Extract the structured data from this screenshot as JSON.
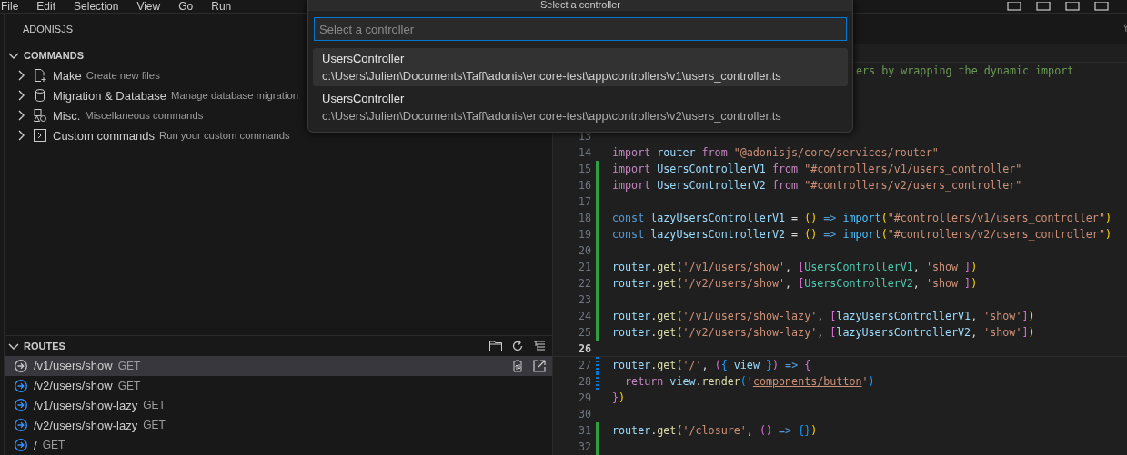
{
  "menu_bar": [
    "File",
    "Edit",
    "Selection",
    "View",
    "Go",
    "Run"
  ],
  "sidebar": {
    "title": "ADONISJS",
    "commands": {
      "label": "COMMANDS",
      "expanded": true,
      "items": [
        {
          "label": "Make",
          "description": "Create new files",
          "kind": "file",
          "expanded": false
        },
        {
          "label": "Migration & Database",
          "description": "Manage database migration",
          "kind": "database",
          "expanded": false
        },
        {
          "label": "Misc.",
          "description": "Miscellaneous commands",
          "kind": "shapes",
          "expanded": false
        },
        {
          "label": "Custom commands",
          "description": "Run your custom commands",
          "kind": "terminal",
          "expanded": false
        }
      ]
    },
    "routes": {
      "label": "ROUTES",
      "expanded": true,
      "items": [
        {
          "path": "/v1/users/show",
          "method": "GET",
          "selected": true
        },
        {
          "path": "/v2/users/show",
          "method": "GET",
          "selected": false
        },
        {
          "path": "/v1/users/show-lazy",
          "method": "GET",
          "selected": false
        },
        {
          "path": "/v2/users/show-lazy",
          "method": "GET",
          "selected": false
        },
        {
          "path": "/",
          "method": "GET",
          "selected": false
        }
      ]
    }
  },
  "quick_pick": {
    "title": "Select a controller",
    "placeholder": "Select a controller",
    "items": [
      {
        "label": "UsersController",
        "detail": "c:\\Users\\Julien\\Documents\\Taff\\adonis\\encore-test\\app\\controllers\\v1\\users_controller.ts",
        "selected": true
      },
      {
        "label": "UsersController",
        "detail": "c:\\Users\\Julien\\Documents\\Taff\\adonis\\encore-test\\app\\controllers\\v2\\users_controller.ts",
        "selected": false
      }
    ]
  },
  "editor": {
    "lines": [
      {
        "clipped": true,
        "tokens": [
          {
            "text": "ers by wrapping the dynamic import",
            "kind": "comment"
          }
        ]
      },
      {
        "number": "13",
        "added": false,
        "modified": false
      },
      {
        "number": "14",
        "added": false,
        "modified": false,
        "tokens": [
          {
            "text": "import ",
            "kind": "keyword"
          },
          {
            "text": "router ",
            "kind": "variable"
          },
          {
            "text": "from ",
            "kind": "keyword"
          },
          {
            "text": "\"@adonisjs/core/services/router\"",
            "kind": "string"
          }
        ]
      },
      {
        "number": "15",
        "added": true,
        "modified": false,
        "tokens": [
          {
            "text": "import ",
            "kind": "keyword"
          },
          {
            "text": "UsersControllerV1 ",
            "kind": "variable"
          },
          {
            "text": "from ",
            "kind": "keyword"
          },
          {
            "text": "\"#controllers/v1/users_controller\"",
            "kind": "string"
          }
        ]
      },
      {
        "number": "16",
        "added": true,
        "modified": false,
        "tokens": [
          {
            "text": "import ",
            "kind": "keyword"
          },
          {
            "text": "UsersControllerV2 ",
            "kind": "variable"
          },
          {
            "text": "from ",
            "kind": "keyword"
          },
          {
            "text": "\"#controllers/v2/users_controller\"",
            "kind": "string"
          }
        ]
      },
      {
        "number": "17",
        "added": true,
        "modified": false
      },
      {
        "number": "18",
        "added": true,
        "modified": false,
        "tokens": [
          {
            "text": "const ",
            "kind": "storage"
          },
          {
            "text": "lazyUsersControllerV1",
            "kind": "variable"
          },
          {
            "text": " = ",
            "kind": "plain"
          },
          {
            "text": "() ",
            "kind": "bracket1"
          },
          {
            "text": "=> ",
            "kind": "storage"
          },
          {
            "text": "import",
            "kind": "call"
          },
          {
            "text": "(",
            "kind": "bracket1"
          },
          {
            "text": "\"#controllers/v1/users_controller\"",
            "kind": "string"
          },
          {
            "text": ")",
            "kind": "bracket1"
          }
        ]
      },
      {
        "number": "19",
        "added": true,
        "modified": false,
        "tokens": [
          {
            "text": "const ",
            "kind": "storage"
          },
          {
            "text": "lazyUsersControllerV2",
            "kind": "variable"
          },
          {
            "text": " = ",
            "kind": "plain"
          },
          {
            "text": "() ",
            "kind": "bracket1"
          },
          {
            "text": "=> ",
            "kind": "storage"
          },
          {
            "text": "import",
            "kind": "call"
          },
          {
            "text": "(",
            "kind": "bracket1"
          },
          {
            "text": "\"#controllers/v2/users_controller\"",
            "kind": "string"
          },
          {
            "text": ")",
            "kind": "bracket1"
          }
        ]
      },
      {
        "number": "20",
        "added": true,
        "modified": false
      },
      {
        "number": "21",
        "added": true,
        "modified": false,
        "tokens": [
          {
            "text": "router",
            "kind": "variable"
          },
          {
            "text": ".",
            "kind": "plain"
          },
          {
            "text": "get",
            "kind": "function"
          },
          {
            "text": "(",
            "kind": "bracket1"
          },
          {
            "text": "'/v1/users/show'",
            "kind": "string"
          },
          {
            "text": ", ",
            "kind": "plain"
          },
          {
            "text": "[",
            "kind": "bracket2"
          },
          {
            "text": "UsersControllerV1",
            "kind": "class"
          },
          {
            "text": ", ",
            "kind": "plain"
          },
          {
            "text": "'show'",
            "kind": "string"
          },
          {
            "text": "]",
            "kind": "bracket2"
          },
          {
            "text": ")",
            "kind": "bracket1"
          }
        ]
      },
      {
        "number": "22",
        "added": true,
        "modified": false,
        "tokens": [
          {
            "text": "router",
            "kind": "variable"
          },
          {
            "text": ".",
            "kind": "plain"
          },
          {
            "text": "get",
            "kind": "function"
          },
          {
            "text": "(",
            "kind": "bracket1"
          },
          {
            "text": "'/v2/users/show'",
            "kind": "string"
          },
          {
            "text": ", ",
            "kind": "plain"
          },
          {
            "text": "[",
            "kind": "bracket2"
          },
          {
            "text": "UsersControllerV2",
            "kind": "class"
          },
          {
            "text": ", ",
            "kind": "plain"
          },
          {
            "text": "'show'",
            "kind": "string"
          },
          {
            "text": "]",
            "kind": "bracket2"
          },
          {
            "text": ")",
            "kind": "bracket1"
          }
        ]
      },
      {
        "number": "23",
        "added": true,
        "modified": false
      },
      {
        "number": "24",
        "added": true,
        "modified": false,
        "tokens": [
          {
            "text": "router",
            "kind": "variable"
          },
          {
            "text": ".",
            "kind": "plain"
          },
          {
            "text": "get",
            "kind": "function"
          },
          {
            "text": "(",
            "kind": "bracket1"
          },
          {
            "text": "'/v1/users/show-lazy'",
            "kind": "string"
          },
          {
            "text": ", ",
            "kind": "plain"
          },
          {
            "text": "[",
            "kind": "bracket2"
          },
          {
            "text": "lazyUsersControllerV1",
            "kind": "variable"
          },
          {
            "text": ", ",
            "kind": "plain"
          },
          {
            "text": "'show'",
            "kind": "string"
          },
          {
            "text": "]",
            "kind": "bracket2"
          },
          {
            "text": ")",
            "kind": "bracket1"
          }
        ]
      },
      {
        "number": "25",
        "added": true,
        "modified": false,
        "tokens": [
          {
            "text": "router",
            "kind": "variable"
          },
          {
            "text": ".",
            "kind": "plain"
          },
          {
            "text": "get",
            "kind": "function"
          },
          {
            "text": "(",
            "kind": "bracket1"
          },
          {
            "text": "'/v2/users/show-lazy'",
            "kind": "string"
          },
          {
            "text": ", ",
            "kind": "plain"
          },
          {
            "text": "[",
            "kind": "bracket2"
          },
          {
            "text": "lazyUsersControllerV2",
            "kind": "variable"
          },
          {
            "text": ", ",
            "kind": "plain"
          },
          {
            "text": "'show'",
            "kind": "string"
          },
          {
            "text": "]",
            "kind": "bracket2"
          },
          {
            "text": ")",
            "kind": "bracket1"
          }
        ]
      },
      {
        "number": "26",
        "current": true,
        "added": false,
        "modified": false
      },
      {
        "number": "27",
        "added": false,
        "modified": true,
        "tokens": [
          {
            "text": "router",
            "kind": "variable"
          },
          {
            "text": ".",
            "kind": "plain"
          },
          {
            "text": "get",
            "kind": "function"
          },
          {
            "text": "(",
            "kind": "bracket1"
          },
          {
            "text": "'/'",
            "kind": "string"
          },
          {
            "text": ", ",
            "kind": "plain"
          },
          {
            "text": "(",
            "kind": "bracket2"
          },
          {
            "text": "{",
            "kind": "bracket3"
          },
          {
            "text": " view ",
            "kind": "variable"
          },
          {
            "text": "}",
            "kind": "bracket3"
          },
          {
            "text": ")",
            "kind": "bracket2"
          },
          {
            "text": " => ",
            "kind": "storage"
          },
          {
            "text": "{",
            "kind": "bracket2"
          }
        ]
      },
      {
        "number": "28",
        "added": false,
        "modified": true,
        "tokens": [
          {
            "text": "  return ",
            "kind": "keyword"
          },
          {
            "text": "view",
            "kind": "variable"
          },
          {
            "text": ".",
            "kind": "plain"
          },
          {
            "text": "render",
            "kind": "function"
          },
          {
            "text": "(",
            "kind": "bracket3"
          },
          {
            "text": "'",
            "kind": "string"
          },
          {
            "text": "components/button",
            "kind": "link"
          },
          {
            "text": "'",
            "kind": "string"
          },
          {
            "text": ")",
            "kind": "bracket3"
          }
        ]
      },
      {
        "number": "29",
        "added": false,
        "modified": false,
        "tokens": [
          {
            "text": "}",
            "kind": "bracket2"
          },
          {
            "text": ")",
            "kind": "bracket1"
          }
        ]
      },
      {
        "number": "30",
        "added": false,
        "modified": false
      },
      {
        "number": "31",
        "added": true,
        "modified": false,
        "tokens": [
          {
            "text": "router",
            "kind": "variable"
          },
          {
            "text": ".",
            "kind": "plain"
          },
          {
            "text": "get",
            "kind": "function"
          },
          {
            "text": "(",
            "kind": "bracket1"
          },
          {
            "text": "'/closure'",
            "kind": "string"
          },
          {
            "text": ", ",
            "kind": "plain"
          },
          {
            "text": "() ",
            "kind": "bracket2"
          },
          {
            "text": "=> ",
            "kind": "storage"
          },
          {
            "text": "{}",
            "kind": "bracket3"
          },
          {
            "text": ")",
            "kind": "bracket1"
          }
        ]
      },
      {
        "number": "32",
        "added": true,
        "modified": false
      }
    ]
  }
}
